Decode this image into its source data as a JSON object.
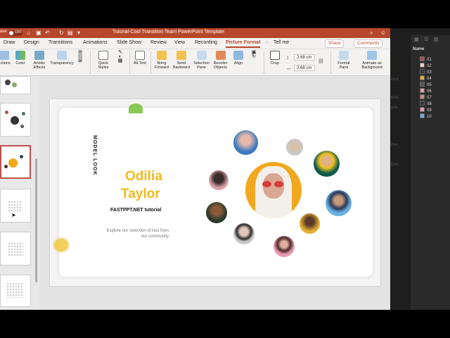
{
  "titlebar": {
    "autosave_label": "ave",
    "toggle_state": "OFF",
    "document_title": "Tutorial-Cool Transition Team PowerPoint Template"
  },
  "tabs": [
    {
      "label": "Draw"
    },
    {
      "label": "Design"
    },
    {
      "label": "Transitions"
    },
    {
      "label": "Animations"
    },
    {
      "label": "Slide Show"
    },
    {
      "label": "Review"
    },
    {
      "label": "View"
    },
    {
      "label": "Recording"
    },
    {
      "label": "Picture Format"
    },
    {
      "label": "Tell me"
    }
  ],
  "share_label": "Share",
  "comments_label": "Comments",
  "ribbon": {
    "corrections": "ections",
    "color": "Color",
    "artistic_effects": "Artistic Effects",
    "transparency": "Transparency",
    "quick_styles": "Quick Styles",
    "alt_text": "Alt Text",
    "bring_forward": "Bring Forward",
    "send_backward": "Send Backward",
    "selection_pane": "Selection Pane",
    "reorder_objects": "Reorder Objects",
    "align": "Align",
    "crop": "Crop",
    "height": "2.68 cm",
    "width": "2.68 cm",
    "format_pane": "Format Pane",
    "animate_as_background": "Animate as Background"
  },
  "slide": {
    "vertical_text": "MODEL LOOK",
    "name_line1": "Odilia",
    "name_line2": "Taylor",
    "subtitle": "FASTPPT.NET tutorial",
    "description": "Explore our selection of lists from our community"
  },
  "layers": {
    "header": "Name",
    "items": [
      "01",
      "02",
      "03",
      "04",
      "05",
      "06",
      "07",
      "08",
      "09",
      "10"
    ]
  },
  "ghost_texts": [
    "ions",
    "ents",
    "ads",
    "rive",
    "Disc"
  ],
  "colors": {
    "accent_red": "#b7472a",
    "name_yellow": "#f2b91e",
    "green_blob": "#7dc241"
  }
}
